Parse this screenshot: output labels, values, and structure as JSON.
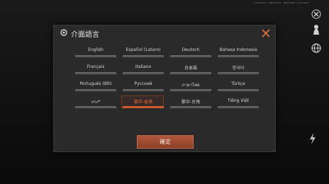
{
  "status_bar": {
    "version_text": "1.2.0.12311 · 2023-05-01 · 1600*1200 · v0.1.12311"
  },
  "side_icons": [
    {
      "name": "close-x-icon",
      "glyph": "✕"
    },
    {
      "name": "pawn-icon",
      "glyph": "♟"
    },
    {
      "name": "globe-icon",
      "glyph": "◍"
    }
  ],
  "dialog": {
    "title": "介面語言",
    "close_icon": "close-icon",
    "languages": [
      {
        "label": "English",
        "selected": false
      },
      {
        "label": "Español (Latam)",
        "selected": false
      },
      {
        "label": "Deutsch",
        "selected": false
      },
      {
        "label": "Bahasa Indonesia",
        "selected": false
      },
      {
        "label": "Français",
        "selected": false
      },
      {
        "label": "Italiano",
        "selected": false
      },
      {
        "label": "日本語",
        "selected": false
      },
      {
        "label": "한국어",
        "selected": false
      },
      {
        "label": "Português (BR)",
        "selected": false
      },
      {
        "label": "Русский",
        "selected": false
      },
      {
        "label": "ภาษาไทย",
        "selected": false
      },
      {
        "label": "Türkçe",
        "selected": false
      },
      {
        "label": "عربي",
        "selected": false
      },
      {
        "label": "繁中-香港",
        "selected": true
      },
      {
        "label": "繁中-台灣",
        "selected": false
      },
      {
        "label": "Tiếng Việt",
        "selected": false
      }
    ],
    "confirm_label": "確定"
  },
  "colors": {
    "accent": "#c8542a",
    "selected_text": "#e86a3a",
    "dialog_bg": "#2a2a2a"
  }
}
